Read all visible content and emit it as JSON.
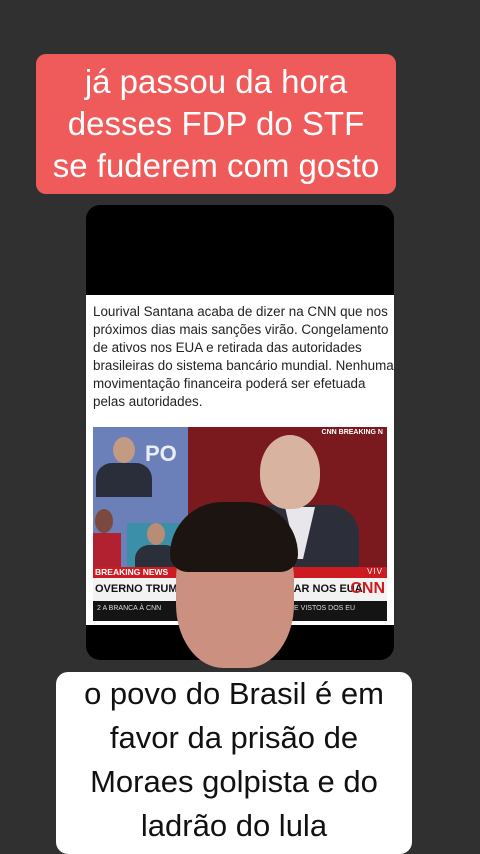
{
  "top_caption": {
    "lines": [
      "já passou da hora",
      "desses FDP do STF",
      "se fuderem com gosto"
    ]
  },
  "post": {
    "lines": [
      "Lourival Santana acaba de dizer na CNN que nos",
      "próximos dias mais sanções virão. Congelamento",
      "de ativos nos EUA e retirada das autoridades",
      "brasileiras do sistema bancário mundial. Nenhuma",
      "movimentação financeira poderá ser efetuada",
      "pelas autoridades."
    ]
  },
  "news_frame": {
    "breaking_tag": "CNN BREAKING N",
    "studio_text": "PO",
    "breaking_news": "BREAKING NEWS",
    "viv": "VIV",
    "headline_left": "OVERNO TRUMP PRO",
    "headline_right": "NTRAR NOS EUA",
    "logo": "CNN",
    "subticker_left": "2 A BRANCA À CNN",
    "subticker_right": "DE VISTOS DOS EU"
  },
  "bottom_caption": {
    "lines": [
      "o povo do Brasil é em",
      "favor da prisão de",
      "Moraes golpista e do",
      "ladrão do lula"
    ]
  },
  "colors": {
    "banner": "#ef5a5a",
    "background": "#303030",
    "cnn_red": "#cc1c22"
  }
}
